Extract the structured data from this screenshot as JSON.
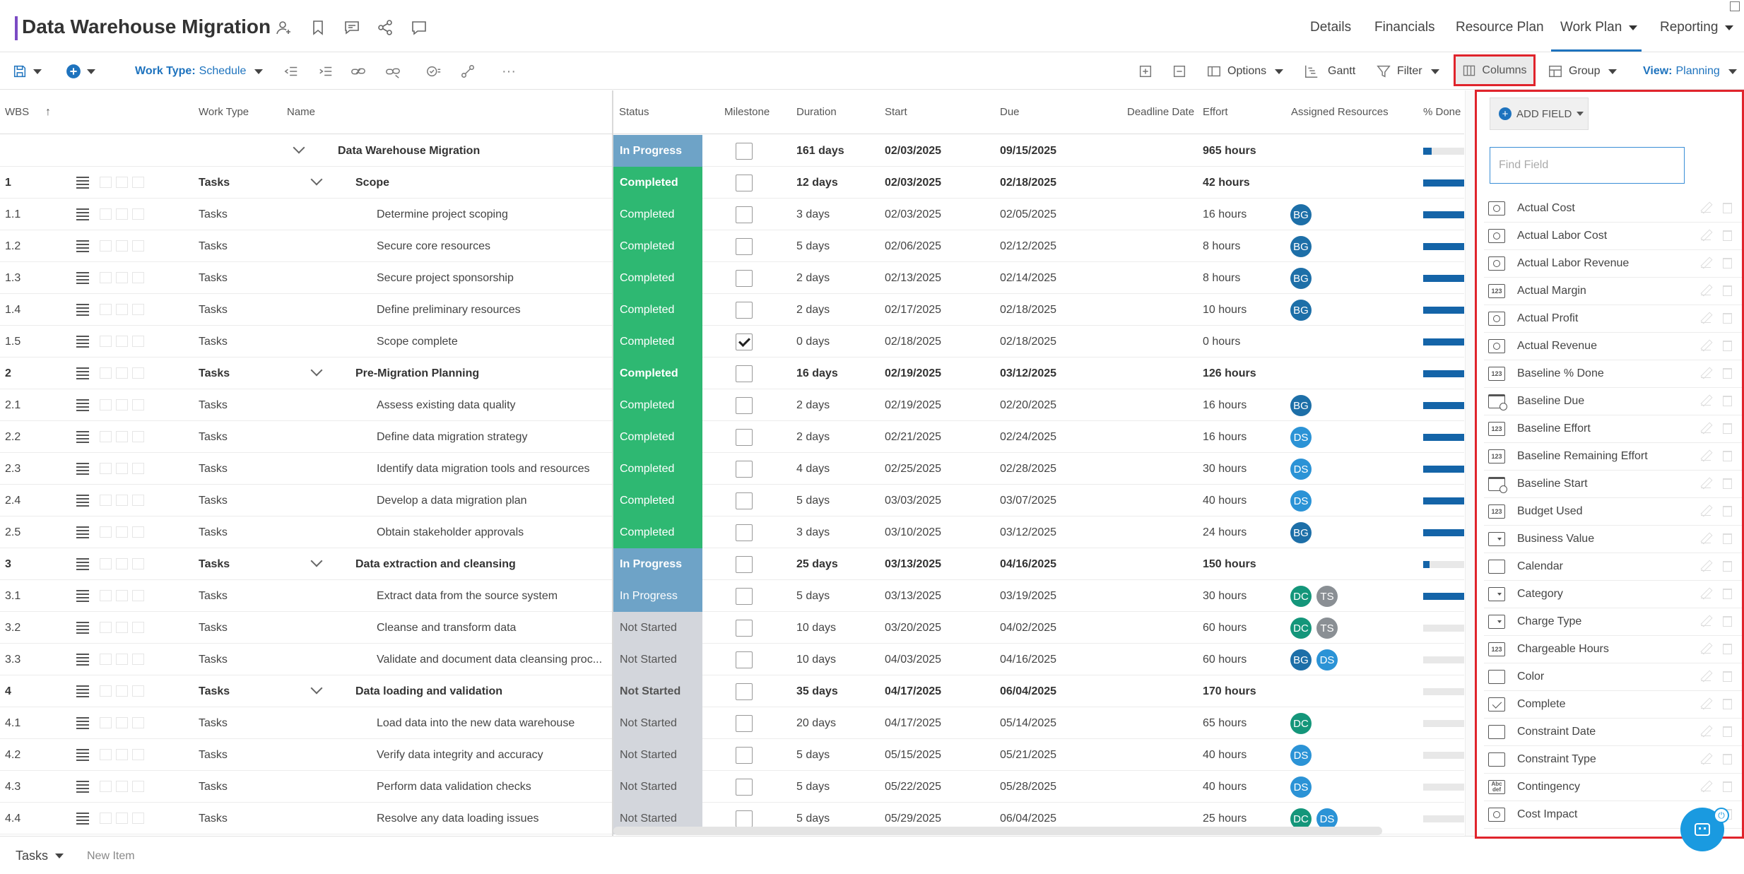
{
  "header": {
    "title": "Data Warehouse Migration",
    "nav": [
      {
        "label": "Details",
        "dropdown": false
      },
      {
        "label": "Financials",
        "dropdown": false
      },
      {
        "label": "Resource Plan",
        "dropdown": false
      },
      {
        "label": "Work Plan",
        "dropdown": true,
        "active": true
      },
      {
        "label": "Reporting",
        "dropdown": true
      }
    ],
    "accent_color": "#7b4bc4"
  },
  "toolbar": {
    "work_type_label": "Work Type:",
    "work_type_value": "Schedule",
    "options_label": "Options",
    "gantt_label": "Gantt",
    "filter_label": "Filter",
    "columns_label": "Columns",
    "group_label": "Group",
    "view_label": "View:",
    "view_value": "Planning",
    "more": "···"
  },
  "grid": {
    "headers": {
      "wbs": "WBS",
      "work_type": "Work Type",
      "name": "Name",
      "status": "Status",
      "milestone": "Milestone",
      "duration": "Duration",
      "start": "Start",
      "due": "Due",
      "deadline": "Deadline Date",
      "effort": "Effort",
      "resources": "Assigned Resources",
      "pct_done": "% Done"
    },
    "status_colors": {
      "In Progress": "#6ea3c7",
      "Completed": "#2eb872",
      "Not Started": "#d3d6dc"
    },
    "rows": [
      {
        "wbs": "",
        "type": "",
        "name": "Data Warehouse Migration",
        "level": 0,
        "summary": true,
        "status": "In Progress",
        "milestone": false,
        "duration": "161 days",
        "start": "02/03/2025",
        "due": "09/15/2025",
        "effort": "965 hours",
        "resources": [],
        "pct": 0.2
      },
      {
        "wbs": "1",
        "type": "Tasks",
        "name": "Scope",
        "level": 1,
        "summary": true,
        "status": "Completed",
        "milestone": false,
        "duration": "12 days",
        "start": "02/03/2025",
        "due": "02/18/2025",
        "effort": "42 hours",
        "resources": [],
        "pct": 1
      },
      {
        "wbs": "1.1",
        "type": "Tasks",
        "name": "Determine project scoping",
        "level": 2,
        "summary": false,
        "status": "Completed",
        "milestone": false,
        "duration": "3 days",
        "start": "02/03/2025",
        "due": "02/05/2025",
        "effort": "16 hours",
        "resources": [
          "BG"
        ],
        "pct": 1
      },
      {
        "wbs": "1.2",
        "type": "Tasks",
        "name": "Secure core resources",
        "level": 2,
        "summary": false,
        "status": "Completed",
        "milestone": false,
        "duration": "5 days",
        "start": "02/06/2025",
        "due": "02/12/2025",
        "effort": "8 hours",
        "resources": [
          "BG"
        ],
        "pct": 1
      },
      {
        "wbs": "1.3",
        "type": "Tasks",
        "name": "Secure project sponsorship",
        "level": 2,
        "summary": false,
        "status": "Completed",
        "milestone": false,
        "duration": "2 days",
        "start": "02/13/2025",
        "due": "02/14/2025",
        "effort": "8 hours",
        "resources": [
          "BG"
        ],
        "pct": 1
      },
      {
        "wbs": "1.4",
        "type": "Tasks",
        "name": "Define preliminary resources",
        "level": 2,
        "summary": false,
        "status": "Completed",
        "milestone": false,
        "duration": "2 days",
        "start": "02/17/2025",
        "due": "02/18/2025",
        "effort": "10 hours",
        "resources": [
          "BG"
        ],
        "pct": 1
      },
      {
        "wbs": "1.5",
        "type": "Tasks",
        "name": "Scope complete",
        "level": 2,
        "summary": false,
        "status": "Completed",
        "milestone": true,
        "duration": "0 days",
        "start": "02/18/2025",
        "due": "02/18/2025",
        "effort": "0 hours",
        "resources": [],
        "pct": 1
      },
      {
        "wbs": "2",
        "type": "Tasks",
        "name": "Pre-Migration Planning",
        "level": 1,
        "summary": true,
        "status": "Completed",
        "milestone": false,
        "duration": "16 days",
        "start": "02/19/2025",
        "due": "03/12/2025",
        "effort": "126 hours",
        "resources": [],
        "pct": 1
      },
      {
        "wbs": "2.1",
        "type": "Tasks",
        "name": "Assess existing data quality",
        "level": 2,
        "summary": false,
        "status": "Completed",
        "milestone": false,
        "duration": "2 days",
        "start": "02/19/2025",
        "due": "02/20/2025",
        "effort": "16 hours",
        "resources": [
          "BG"
        ],
        "pct": 1
      },
      {
        "wbs": "2.2",
        "type": "Tasks",
        "name": "Define data migration strategy",
        "level": 2,
        "summary": false,
        "status": "Completed",
        "milestone": false,
        "duration": "2 days",
        "start": "02/21/2025",
        "due": "02/24/2025",
        "effort": "16 hours",
        "resources": [
          "DS"
        ],
        "pct": 1
      },
      {
        "wbs": "2.3",
        "type": "Tasks",
        "name": "Identify data migration tools and resources",
        "level": 2,
        "summary": false,
        "status": "Completed",
        "milestone": false,
        "duration": "4 days",
        "start": "02/25/2025",
        "due": "02/28/2025",
        "effort": "30 hours",
        "resources": [
          "DS"
        ],
        "pct": 1
      },
      {
        "wbs": "2.4",
        "type": "Tasks",
        "name": "Develop a data migration plan",
        "level": 2,
        "summary": false,
        "status": "Completed",
        "milestone": false,
        "duration": "5 days",
        "start": "03/03/2025",
        "due": "03/07/2025",
        "effort": "40 hours",
        "resources": [
          "DS"
        ],
        "pct": 1
      },
      {
        "wbs": "2.5",
        "type": "Tasks",
        "name": "Obtain stakeholder approvals",
        "level": 2,
        "summary": false,
        "status": "Completed",
        "milestone": false,
        "duration": "3 days",
        "start": "03/10/2025",
        "due": "03/12/2025",
        "effort": "24 hours",
        "resources": [
          "BG"
        ],
        "pct": 1
      },
      {
        "wbs": "3",
        "type": "Tasks",
        "name": "Data extraction and cleansing",
        "level": 1,
        "summary": true,
        "status": "In Progress",
        "milestone": false,
        "duration": "25 days",
        "start": "03/13/2025",
        "due": "04/16/2025",
        "effort": "150 hours",
        "resources": [],
        "pct": 0.15
      },
      {
        "wbs": "3.1",
        "type": "Tasks",
        "name": "Extract data from the source system",
        "level": 2,
        "summary": false,
        "status": "In Progress",
        "milestone": false,
        "duration": "5 days",
        "start": "03/13/2025",
        "due": "03/19/2025",
        "effort": "30 hours",
        "resources": [
          "DC",
          "TS"
        ],
        "pct": 1
      },
      {
        "wbs": "3.2",
        "type": "Tasks",
        "name": "Cleanse and transform data",
        "level": 2,
        "summary": false,
        "status": "Not Started",
        "milestone": false,
        "duration": "10 days",
        "start": "03/20/2025",
        "due": "04/02/2025",
        "effort": "60 hours",
        "resources": [
          "DC",
          "TS"
        ],
        "pct": 0
      },
      {
        "wbs": "3.3",
        "type": "Tasks",
        "name": "Validate and document data cleansing proc...",
        "level": 2,
        "summary": false,
        "status": "Not Started",
        "milestone": false,
        "duration": "10 days",
        "start": "04/03/2025",
        "due": "04/16/2025",
        "effort": "60 hours",
        "resources": [
          "BG",
          "DS"
        ],
        "pct": 0
      },
      {
        "wbs": "4",
        "type": "Tasks",
        "name": "Data loading and validation",
        "level": 1,
        "summary": true,
        "status": "Not Started",
        "milestone": false,
        "duration": "35 days",
        "start": "04/17/2025",
        "due": "06/04/2025",
        "effort": "170 hours",
        "resources": [],
        "pct": 0
      },
      {
        "wbs": "4.1",
        "type": "Tasks",
        "name": "Load data into the new data warehouse",
        "level": 2,
        "summary": false,
        "status": "Not Started",
        "milestone": false,
        "duration": "20 days",
        "start": "04/17/2025",
        "due": "05/14/2025",
        "effort": "65 hours",
        "resources": [
          "DC"
        ],
        "pct": 0
      },
      {
        "wbs": "4.2",
        "type": "Tasks",
        "name": "Verify data integrity and accuracy",
        "level": 2,
        "summary": false,
        "status": "Not Started",
        "milestone": false,
        "duration": "5 days",
        "start": "05/15/2025",
        "due": "05/21/2025",
        "effort": "40 hours",
        "resources": [
          "DS"
        ],
        "pct": 0
      },
      {
        "wbs": "4.3",
        "type": "Tasks",
        "name": "Perform data validation checks",
        "level": 2,
        "summary": false,
        "status": "Not Started",
        "milestone": false,
        "duration": "5 days",
        "start": "05/22/2025",
        "due": "05/28/2025",
        "effort": "40 hours",
        "resources": [
          "DS"
        ],
        "pct": 0
      },
      {
        "wbs": "4.4",
        "type": "Tasks",
        "name": "Resolve any data loading issues",
        "level": 2,
        "summary": false,
        "status": "Not Started",
        "milestone": false,
        "duration": "5 days",
        "start": "05/29/2025",
        "due": "06/04/2025",
        "effort": "25 hours",
        "resources": [
          "DC",
          "DS"
        ],
        "pct": 0
      }
    ],
    "avatar_colors": {
      "BG": "#1d6fa8",
      "DS": "#2b93d6",
      "DC": "#14967a",
      "TS": "#8a8f94"
    }
  },
  "footer": {
    "tasks_label": "Tasks",
    "new_item_placeholder": "New Item"
  },
  "columns_panel": {
    "add_field_label": "ADD FIELD",
    "find_placeholder": "Find Field",
    "fields": [
      {
        "name": "Actual Cost",
        "icon": "money-icon"
      },
      {
        "name": "Actual Labor Cost",
        "icon": "money-icon"
      },
      {
        "name": "Actual Labor Revenue",
        "icon": "money-icon"
      },
      {
        "name": "Actual Margin",
        "icon": "number-icon"
      },
      {
        "name": "Actual Profit",
        "icon": "money-icon"
      },
      {
        "name": "Actual Revenue",
        "icon": "money-icon"
      },
      {
        "name": "Baseline % Done",
        "icon": "number-icon"
      },
      {
        "name": "Baseline Due",
        "icon": "date-icon"
      },
      {
        "name": "Baseline Effort",
        "icon": "number-icon"
      },
      {
        "name": "Baseline Remaining Effort",
        "icon": "number-icon"
      },
      {
        "name": "Baseline Start",
        "icon": "date-icon"
      },
      {
        "name": "Budget Used",
        "icon": "number-icon"
      },
      {
        "name": "Business Value",
        "icon": "dropdown-icon"
      },
      {
        "name": "Calendar",
        "icon": "blank-icon"
      },
      {
        "name": "Category",
        "icon": "dropdown-icon"
      },
      {
        "name": "Charge Type",
        "icon": "dropdown-icon"
      },
      {
        "name": "Chargeable Hours",
        "icon": "number-icon"
      },
      {
        "name": "Color",
        "icon": "blank-icon"
      },
      {
        "name": "Complete",
        "icon": "checkbox-icon"
      },
      {
        "name": "Constraint Date",
        "icon": "blank-icon"
      },
      {
        "name": "Constraint Type",
        "icon": "blank-icon"
      },
      {
        "name": "Contingency",
        "icon": "text-icon"
      },
      {
        "name": "Cost Impact",
        "icon": "money-icon"
      }
    ],
    "number_icon_text": "123",
    "text_icon_text": "Abc def"
  }
}
